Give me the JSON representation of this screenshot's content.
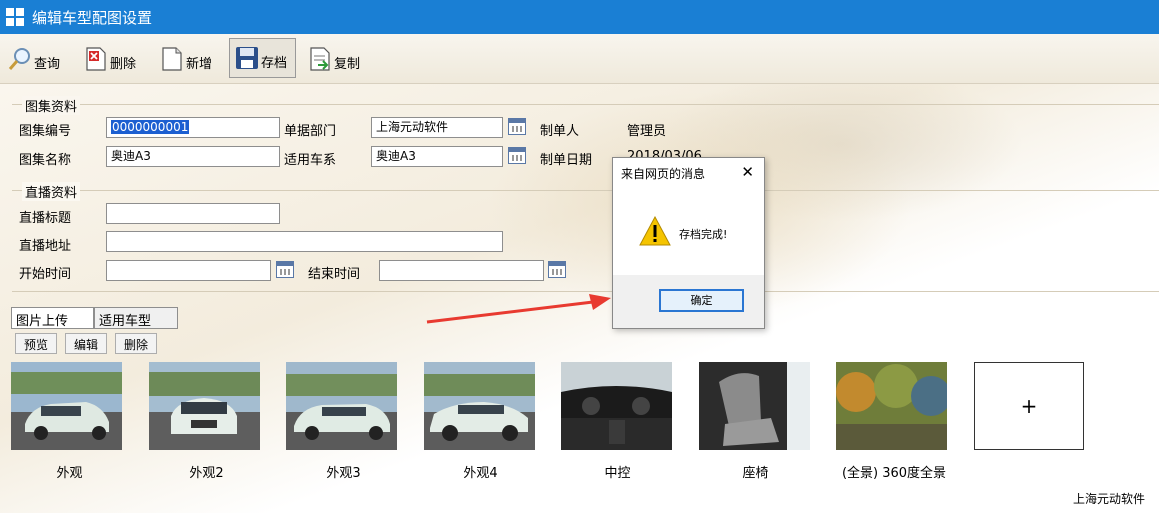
{
  "window": {
    "title": "编辑车型配图设置"
  },
  "toolbar": {
    "query": "查询",
    "delete": "删除",
    "new": "新增",
    "save": "存档",
    "copy": "复制"
  },
  "album": {
    "legend": "图集资料",
    "code_label": "图集编号",
    "code_value": "0000000001",
    "dept_label": "单据部门",
    "dept_value": "上海元动软件",
    "maker_label": "制单人",
    "maker_value": "管理员",
    "name_label": "图集名称",
    "name_value": "奥迪A3",
    "series_label": "适用车系",
    "series_value": "奥迪A3",
    "date_label": "制单日期",
    "date_value": "2018/03/06"
  },
  "live": {
    "legend": "直播资料",
    "title_label": "直播标题",
    "title_value": "",
    "url_label": "直播地址",
    "url_value": "",
    "start_label": "开始时间",
    "start_value": "",
    "end_label": "结束时间",
    "end_value": ""
  },
  "tabs": [
    "图片上传",
    "适用车型"
  ],
  "actions": {
    "preview": "预览",
    "edit": "编辑",
    "remove": "删除"
  },
  "gallery": [
    {
      "caption": "外观",
      "kind": "car-front-angle"
    },
    {
      "caption": "外观2",
      "kind": "car-front"
    },
    {
      "caption": "外观3",
      "kind": "car-side-angle"
    },
    {
      "caption": "外观4",
      "kind": "car-side"
    },
    {
      "caption": "中控",
      "kind": "dashboard"
    },
    {
      "caption": "座椅",
      "kind": "seat"
    },
    {
      "caption": "(全景) 360度全景",
      "kind": "panorama"
    }
  ],
  "add_tile": "+",
  "footer": "上海元动软件",
  "dialog": {
    "title": "来自网页的消息",
    "message": "存档完成!",
    "ok": "确定",
    "close": "✕"
  },
  "colors": {
    "titlebar": "#1a7fd4",
    "selection": "#1c5fd1",
    "arrow": "#e83a30",
    "warning": "#f5c400"
  }
}
